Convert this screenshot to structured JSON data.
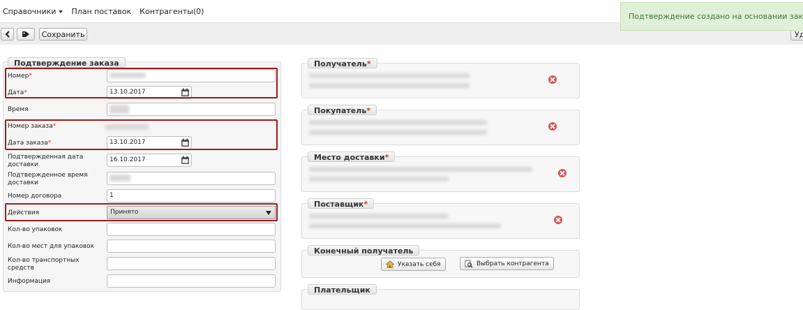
{
  "nav": {
    "directories": "Справочники",
    "supply_plan": "План поставок",
    "counterparties": "Контрагенты(0)"
  },
  "notification": "Подтверждение создано на основании заказа",
  "toolbar": {
    "save": "Сохранить",
    "right_partial": "Уд"
  },
  "form": {
    "legend": "Подтверждение заказа",
    "fields": {
      "number": {
        "label": "Номер",
        "value": ""
      },
      "date": {
        "label": "Дата",
        "value": "13.10.2017"
      },
      "time": {
        "label": "Время",
        "value": ""
      },
      "order_number": {
        "label": "Номер заказа",
        "value": ""
      },
      "order_date": {
        "label": "Дата заказа",
        "value": "13.10.2017"
      },
      "confirmed_delivery_date": {
        "label": "Подтвержденная дата доставки",
        "value": "16.10.2017"
      },
      "confirmed_delivery_time": {
        "label": "Подтвержденное время доставки",
        "value": ""
      },
      "contract_number": {
        "label": "Номер договора",
        "value": "1"
      },
      "actions": {
        "label": "Действия",
        "value": "Принято"
      },
      "packages_count": {
        "label": "Кол-во упаковок",
        "value": ""
      },
      "places_count": {
        "label": "Кол-во мест для упаковок",
        "value": ""
      },
      "transport_count": {
        "label": "Кол-во транспортных средств",
        "value": ""
      },
      "information": {
        "label": "Информация",
        "value": ""
      }
    }
  },
  "parties": {
    "recipient": "Получатель",
    "buyer": "Покупатель",
    "delivery_place": "Место доставки",
    "supplier": "Поставщик",
    "end_recipient": "Конечный получатель",
    "payer": "Плательщик",
    "specify_self": "Указать себя",
    "choose_counterparty": "Выбрать контрагента"
  },
  "colors": {
    "highlight_border": "#9b1c1c",
    "notification_bg": "#dff0d8",
    "notification_text": "#3c763d",
    "remove_icon": "#d9534f"
  }
}
